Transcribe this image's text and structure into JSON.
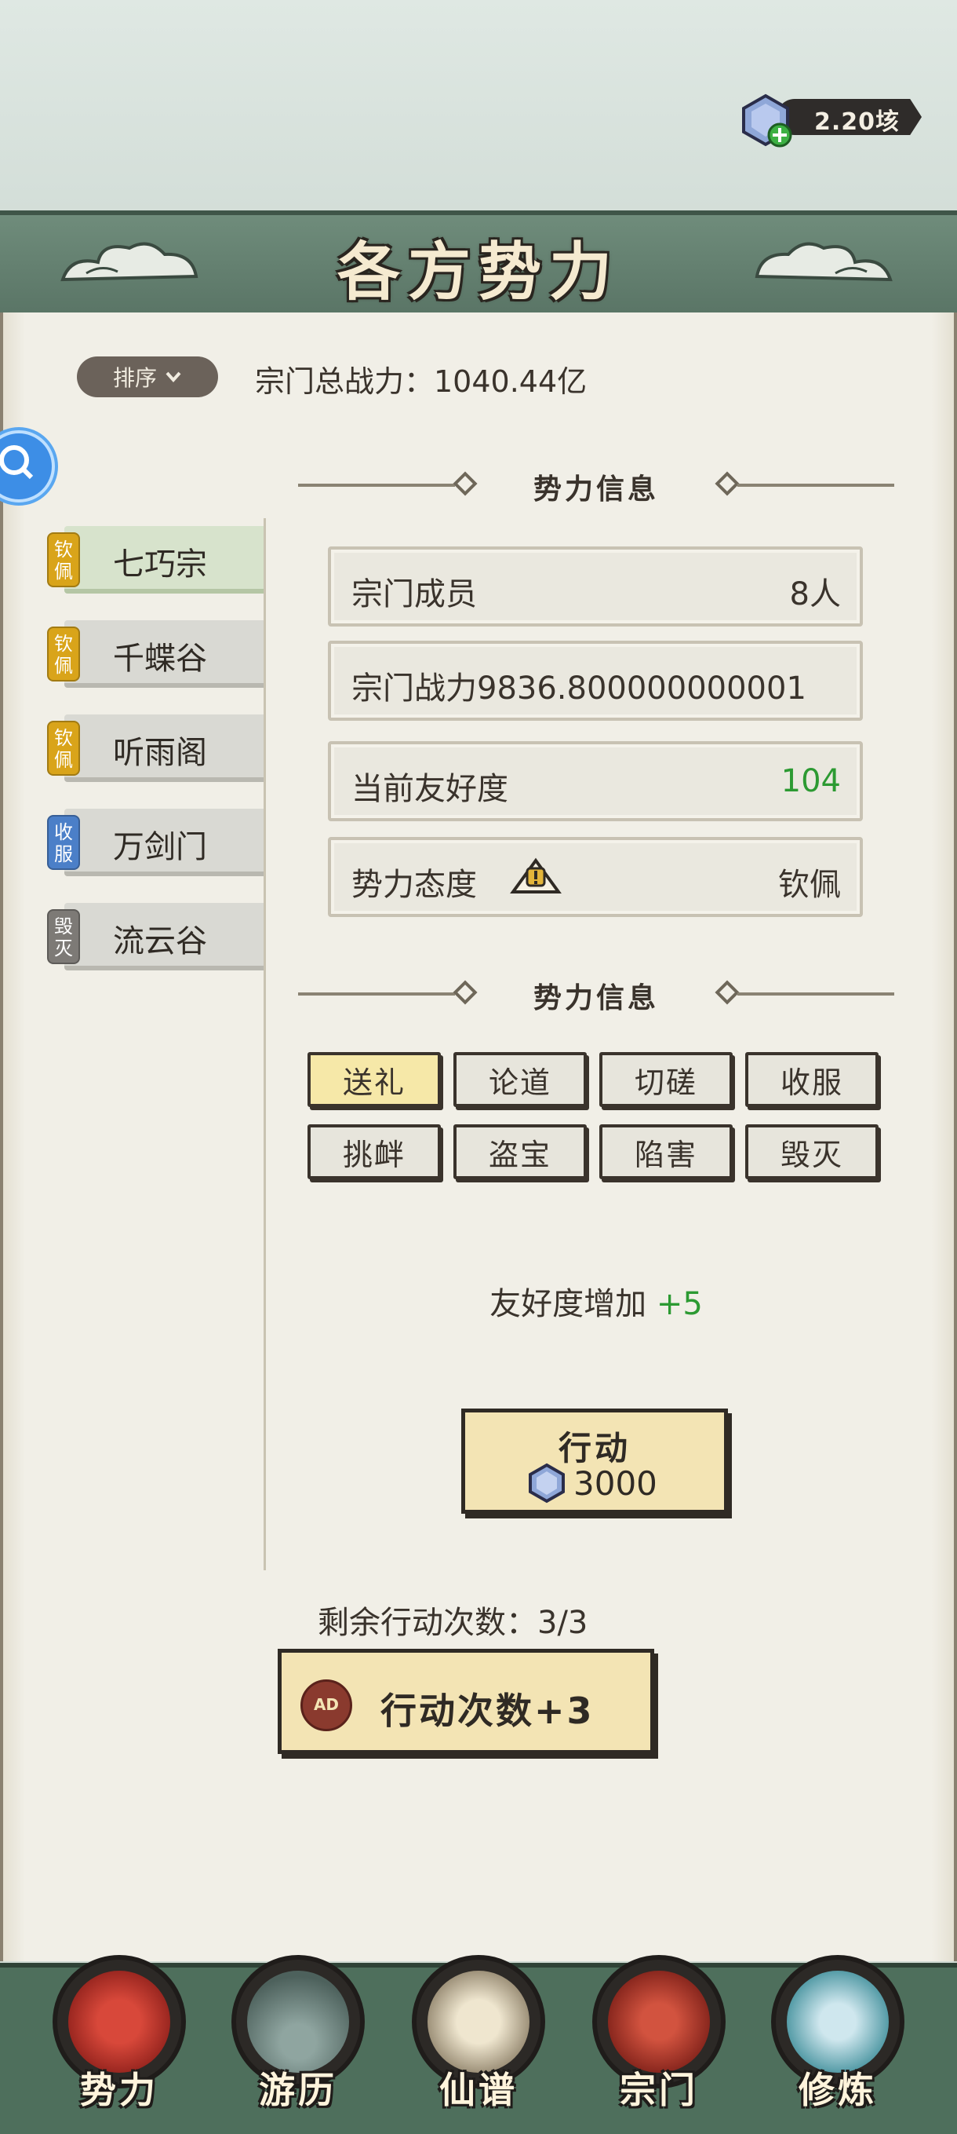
{
  "currency": {
    "amount": "2.20垓",
    "icon": "gem-plus-icon"
  },
  "header": {
    "title": "各方势力"
  },
  "sort": {
    "label": "排序"
  },
  "total_power": "宗门总战力：1040.44亿",
  "sects": [
    {
      "tag": "钦佩",
      "tag_color": "#d9a41a",
      "name": "七巧宗"
    },
    {
      "tag": "钦佩",
      "tag_color": "#d9a41a",
      "name": "千蝶谷"
    },
    {
      "tag": "钦佩",
      "tag_color": "#d9a41a",
      "name": "听雨阁"
    },
    {
      "tag": "收服",
      "tag_color": "#4b7fc8",
      "name": "万剑门"
    },
    {
      "tag": "毁灭",
      "tag_color": "#7d7a76",
      "name": "流云谷"
    }
  ],
  "info_section": {
    "title": "势力信息"
  },
  "info": {
    "members_label": "宗门成员",
    "members_value": "8人",
    "power_label": "宗门战力9836.800000000001",
    "friendship_label": "当前友好度",
    "friendship_value": "104",
    "attitude_label": "势力态度",
    "attitude_value": "钦佩"
  },
  "actions_section": {
    "title": "势力信息"
  },
  "actions": [
    "送礼",
    "论道",
    "切磋",
    "收服",
    "挑衅",
    "盗宝",
    "陷害",
    "毁灭"
  ],
  "effect": {
    "text": "友好度增加 ",
    "value": "+5"
  },
  "do_button": {
    "label": "行动",
    "cost": "3000"
  },
  "remaining": "剩余行动次数：3/3",
  "ad_button": {
    "badge": "AD",
    "label": "行动次数+3"
  },
  "nav": [
    "势力",
    "游历",
    "仙谱",
    "宗门",
    "修炼"
  ],
  "colors": {
    "accent_green": "#2c9a32",
    "banner": "#5a7566",
    "button_gold": "#f3e4b4"
  }
}
